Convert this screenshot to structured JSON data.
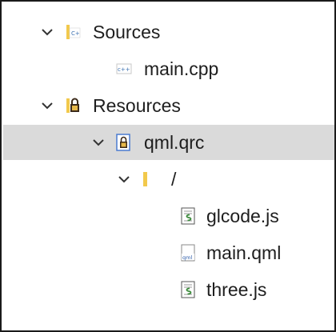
{
  "tree": {
    "items": [
      {
        "label": "Sources",
        "icon": "folder-sources-icon",
        "expanded": true,
        "selected": false
      },
      {
        "label": "main.cpp",
        "icon": "cpp-file-icon",
        "selected": false
      },
      {
        "label": "Resources",
        "icon": "folder-resources-icon",
        "expanded": true,
        "selected": false
      },
      {
        "label": "qml.qrc",
        "icon": "qrc-file-icon",
        "expanded": true,
        "selected": true
      },
      {
        "label": "/",
        "icon": "folder-icon",
        "expanded": true,
        "selected": false
      },
      {
        "label": "glcode.js",
        "icon": "js-file-icon",
        "selected": false
      },
      {
        "label": "main.qml",
        "icon": "qml-file-icon",
        "selected": false
      },
      {
        "label": "three.js",
        "icon": "js-file-icon",
        "selected": false
      }
    ]
  },
  "colors": {
    "selection": "#dadada",
    "folder": "#f2c94c",
    "border": "#1a1a1a",
    "text": "#1e1e1e"
  }
}
